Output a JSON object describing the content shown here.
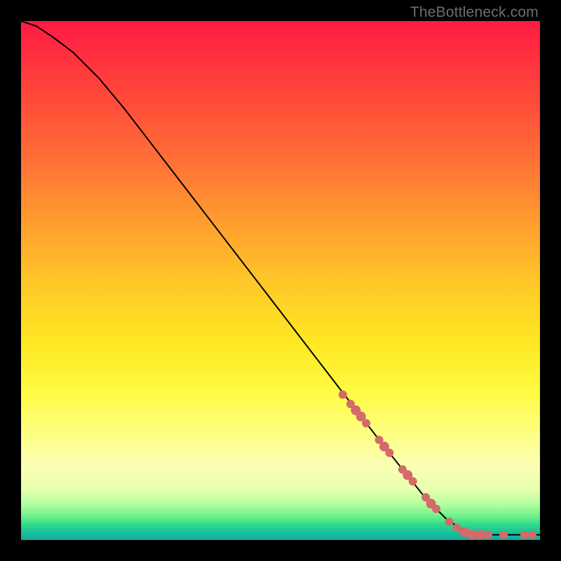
{
  "watermark": {
    "text": "TheBottleneck.com"
  },
  "chart_data": {
    "type": "line",
    "title": "",
    "xlabel": "",
    "ylabel": "",
    "xlim": [
      0,
      100
    ],
    "ylim": [
      0,
      100
    ],
    "series": [
      {
        "name": "curve",
        "x": [
          0,
          3,
          6,
          10,
          15,
          20,
          30,
          40,
          50,
          60,
          65,
          70,
          74,
          78,
          82,
          85,
          88,
          92,
          96,
          100
        ],
        "values": [
          100,
          99,
          97,
          94,
          89,
          83,
          70,
          57,
          44,
          31,
          24.5,
          18,
          13,
          8,
          4,
          2,
          1,
          1,
          1,
          1
        ]
      }
    ],
    "markers": {
      "name": "highlighted-points",
      "color": "#d46a6a",
      "points": [
        {
          "x": 62.0,
          "y": 28.0,
          "r": 6
        },
        {
          "x": 63.5,
          "y": 26.2,
          "r": 6
        },
        {
          "x": 64.5,
          "y": 25.0,
          "r": 7
        },
        {
          "x": 65.5,
          "y": 23.8,
          "r": 7
        },
        {
          "x": 66.5,
          "y": 22.5,
          "r": 6
        },
        {
          "x": 69.0,
          "y": 19.3,
          "r": 6
        },
        {
          "x": 70.0,
          "y": 18.0,
          "r": 7
        },
        {
          "x": 71.0,
          "y": 16.8,
          "r": 6
        },
        {
          "x": 73.5,
          "y": 13.6,
          "r": 6
        },
        {
          "x": 74.5,
          "y": 12.5,
          "r": 7
        },
        {
          "x": 75.5,
          "y": 11.3,
          "r": 6
        },
        {
          "x": 78.0,
          "y": 8.2,
          "r": 6
        },
        {
          "x": 79.0,
          "y": 7.0,
          "r": 7
        },
        {
          "x": 80.0,
          "y": 6.0,
          "r": 6
        },
        {
          "x": 82.5,
          "y": 3.5,
          "r": 6
        },
        {
          "x": 84.0,
          "y": 2.3,
          "r": 6
        },
        {
          "x": 85.5,
          "y": 1.5,
          "r": 7
        },
        {
          "x": 87.0,
          "y": 1.0,
          "r": 7
        },
        {
          "x": 88.5,
          "y": 1.0,
          "r": 7
        },
        {
          "x": 90.0,
          "y": 1.0,
          "r": 6
        },
        {
          "x": 93.0,
          "y": 1.0,
          "r": 6
        },
        {
          "x": 97.0,
          "y": 1.0,
          "r": 6
        },
        {
          "x": 98.5,
          "y": 1.0,
          "r": 6
        }
      ]
    }
  }
}
